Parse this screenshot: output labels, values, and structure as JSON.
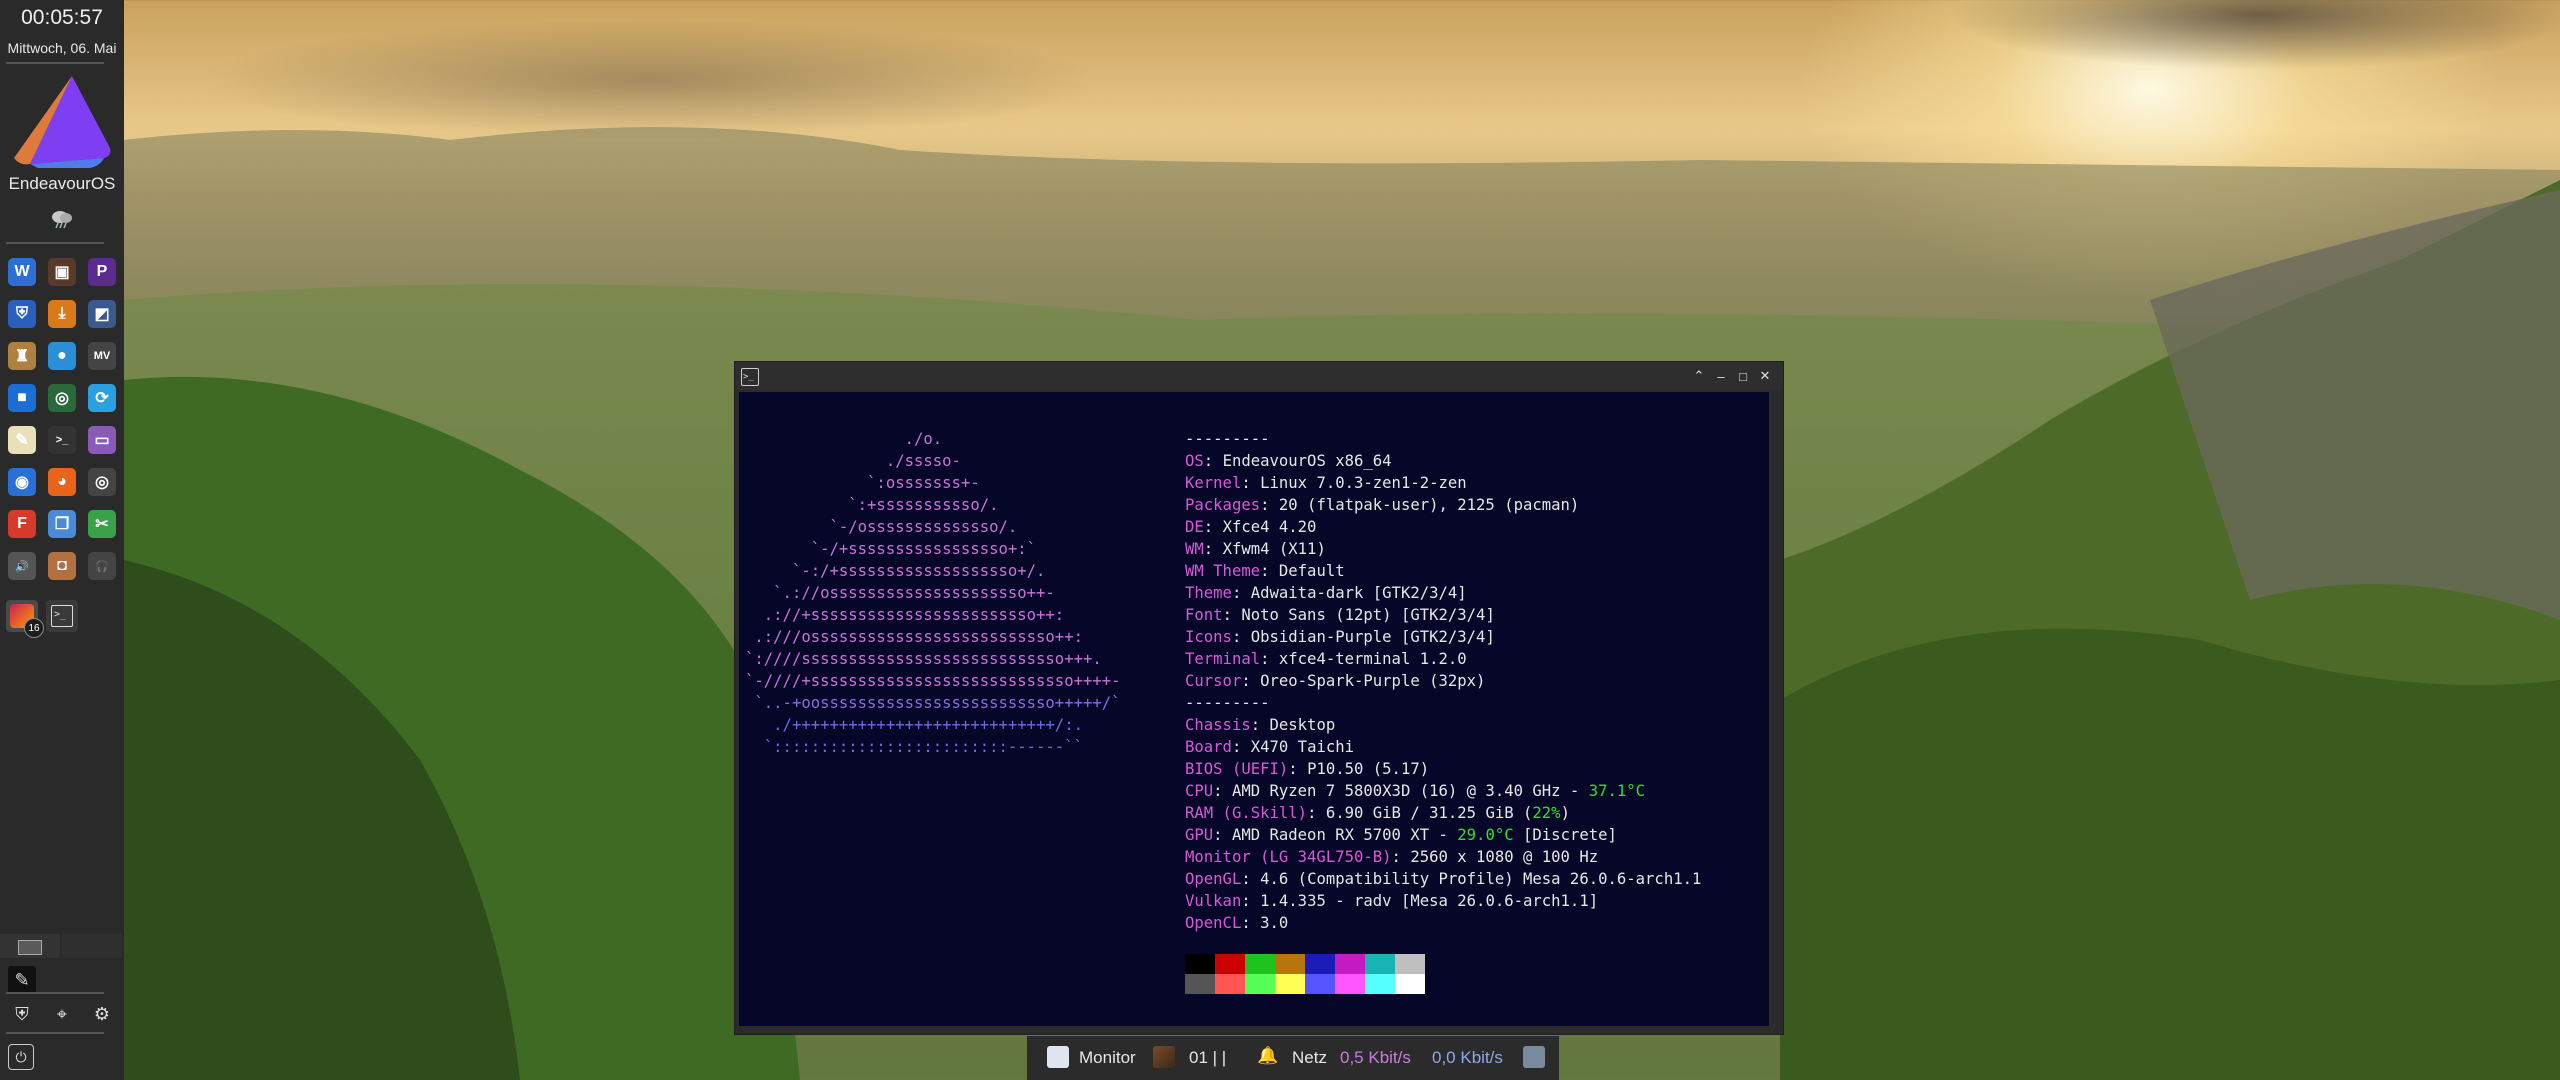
{
  "clock": {
    "time": "00:05:57",
    "date": "Mittwoch, 06. Mai"
  },
  "launcher": {
    "label": "EndeavourOS"
  },
  "dock_icons": [
    "writer-icon",
    "image-viewer-icon",
    "pstore-icon",
    "vpn-shield-icon",
    "downloader-icon",
    "photo-editor-icon",
    "media-tool-icon",
    "globe-icon",
    "mkvtoolnix-icon",
    "video-call-icon",
    "tuner-icon",
    "update-icon",
    "text-editor-icon",
    "terminal-icon",
    "folder-icon",
    "steam-like-icon",
    "firefox-icon",
    "target-icon",
    "flatpak-icon",
    "screenshot-icon",
    "tools-icon",
    "volume-icon",
    "camera-icon",
    "headphones-icon"
  ],
  "tasks": {
    "badge_count": "16"
  },
  "terminal": {
    "ascii_logo": [
      {
        "t": "                 ./o.",
        "c": "#c873d7"
      },
      {
        "t": "               ./sssso-",
        "c": "#c873d7"
      },
      {
        "t": "             `:osssssss+-",
        "c": "#c873d7"
      },
      {
        "t": "           `:+sssssssssso/.",
        "c": "#c873d7"
      },
      {
        "t": "         `-/ossssssssssssso/.",
        "c": "#c873d7"
      },
      {
        "t": "       `-/+sssssssssssssssso+:`",
        "c": "#c873d7"
      },
      {
        "t": "     `-:/+sssssssssssssssssso+/.",
        "c": "#c873d7"
      },
      {
        "t": "   `.://osssssssssssssssssssso++-",
        "c": "#c873d7"
      },
      {
        "t": "  .://+ssssssssssssssssssssssso++:",
        "c": "#c873d7"
      },
      {
        "t": " .:///ossssssssssssssssssssssssso++:",
        "c": "#c873d7"
      },
      {
        "t": "`:////ssssssssssssssssssssssssssso+++.",
        "c": "#c873d7"
      },
      {
        "t": "`-////+ssssssssssssssssssssssssssso++++-",
        "c": "#c873d7"
      },
      {
        "t": " `..-+oosssssssssssssssssssssssso+++++/`",
        "c": "#8a6be0"
      },
      {
        "t": "   ./++++++++++++++++++++++++++++/:.",
        "c": "#6a6ce8"
      },
      {
        "t": "  `:::::::::::::::::::::::::------``",
        "c": "#6a6ce8"
      }
    ],
    "info_lines": [
      {
        "key": "",
        "sep": "",
        "val": "---------"
      },
      {
        "key": "OS",
        "sep": ": ",
        "val": "EndeavourOS x86_64"
      },
      {
        "key": "Kernel",
        "sep": ": ",
        "val": "Linux 7.0.3-zen1-2-zen"
      },
      {
        "key": "Packages",
        "sep": ": ",
        "val": "20 (flatpak-user), 2125 (pacman)"
      },
      {
        "key": "DE",
        "sep": ": ",
        "val": "Xfce4 4.20"
      },
      {
        "key": "WM",
        "sep": ": ",
        "val": "Xfwm4 (X11)"
      },
      {
        "key": "WM Theme",
        "sep": ": ",
        "val": "Default"
      },
      {
        "key": "Theme",
        "sep": ": ",
        "val": "Adwaita-dark [GTK2/3/4]"
      },
      {
        "key": "Font",
        "sep": ": ",
        "val": "Noto Sans (12pt) [GTK2/3/4]"
      },
      {
        "key": "Icons",
        "sep": ": ",
        "val": "Obsidian-Purple [GTK2/3/4]"
      },
      {
        "key": "Terminal",
        "sep": ": ",
        "val": "xfce4-terminal 1.2.0"
      },
      {
        "key": "Cursor",
        "sep": ": ",
        "val": "Oreo-Spark-Purple (32px)"
      },
      {
        "key": "",
        "sep": "",
        "val": "---------"
      },
      {
        "key": "Chassis",
        "sep": ": ",
        "val": "Desktop"
      },
      {
        "key": "Board",
        "sep": ": ",
        "val": "X470 Taichi"
      },
      {
        "key": "BIOS (UEFI)",
        "sep": ": ",
        "val": "P10.50 (5.17)"
      },
      {
        "key": "CPU",
        "sep": ": ",
        "val": "AMD Ryzen 7 5800X3D (16) @ 3.40 GHz - ",
        "hl": "37.1°C",
        "tail": ""
      },
      {
        "key": "RAM (G.Skill)",
        "sep": ": ",
        "val": "6.90 GiB / 31.25 GiB (",
        "hl": "22%",
        "tail": ")"
      },
      {
        "key": "GPU",
        "sep": ": ",
        "val": "AMD Radeon RX 5700 XT - ",
        "hl": "29.0°C",
        "tail": " [Discrete]"
      },
      {
        "key": "Monitor (LG 34GL750-B)",
        "sep": ": ",
        "val": "2560 x 1080 @ 100 Hz"
      },
      {
        "key": "OpenGL",
        "sep": ": ",
        "val": "4.6 (Compatibility Profile) Mesa 26.0.6-arch1.1"
      },
      {
        "key": "Vulkan",
        "sep": ": ",
        "val": "1.4.335 - radv [Mesa 26.0.6-arch1.1]"
      },
      {
        "key": "OpenCL",
        "sep": ": ",
        "val": "3.0"
      }
    ],
    "palette_top": [
      "#000000",
      "#cc0000",
      "#1ec31e",
      "#b8760a",
      "#1b1bb5",
      "#c21cc2",
      "#18b3b3",
      "#bfbfbf"
    ],
    "palette_bottom": [
      "#555555",
      "#ff5555",
      "#55ff55",
      "#ffff55",
      "#5555ff",
      "#ff55ff",
      "#55ffff",
      "#ffffff"
    ]
  },
  "bottom_panel": {
    "monitor_label": "Monitor",
    "workspace_text": "01 |  |",
    "net_label": "Netz",
    "net_down": "0,5 Kbit/s",
    "net_up": "0,0 Kbit/s"
  },
  "colors": {
    "key_color": "#d65bd6",
    "highlight_green": "#2ee02e",
    "net_down_color": "#c87be0",
    "net_up_color": "#8fa6f0"
  }
}
